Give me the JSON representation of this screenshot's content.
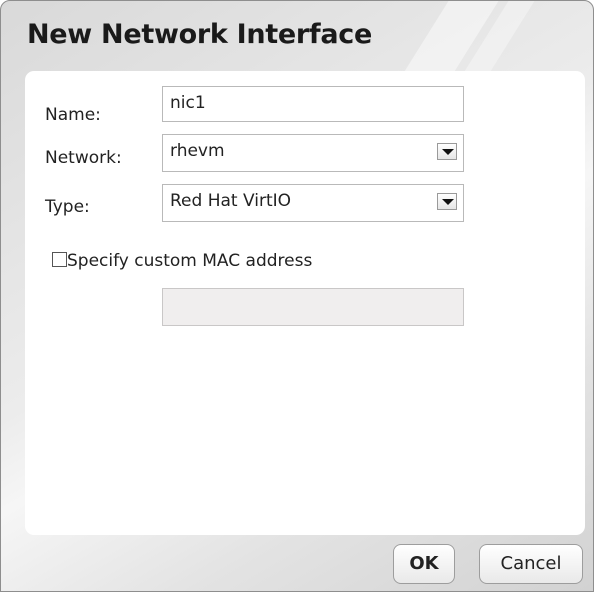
{
  "dialog": {
    "title": "New Network Interface"
  },
  "form": {
    "name_label": "Name:",
    "name_value": "nic1",
    "network_label": "Network:",
    "network_value": "rhevm",
    "type_label": "Type:",
    "type_value": "Red Hat VirtIO",
    "custom_mac_label": "Specify custom MAC address",
    "custom_mac_checked": false,
    "mac_value": ""
  },
  "buttons": {
    "ok_label": "OK",
    "cancel_label": "Cancel"
  }
}
